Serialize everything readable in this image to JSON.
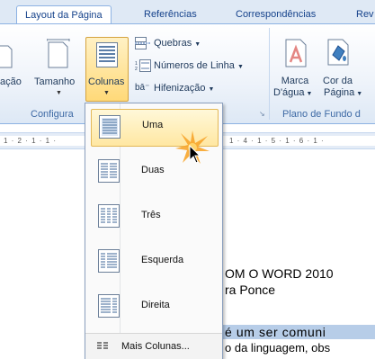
{
  "tabs": [
    {
      "label": "Layout da Página",
      "active": true
    },
    {
      "label": "Referências"
    },
    {
      "label": "Correspondências"
    },
    {
      "label": "Rev"
    }
  ],
  "ribbon": {
    "page_setup": {
      "orientation_label_partial": "ação",
      "size_label": "Tamanho",
      "columns_label": "Colunas",
      "group_title_partial": "Configura",
      "small_buttons": {
        "breaks": "Quebras",
        "line_numbers": "Números de Linha",
        "hyphenation": "Hifenização"
      }
    },
    "page_background": {
      "watermark_line1": "Marca",
      "watermark_line2": "D'água",
      "page_color_line1": "Cor da",
      "page_color_line2": "Página",
      "group_title_partial": "Plano de Fundo d"
    }
  },
  "ruler": {
    "left_text": "1 · 2 · 1 · 1 ·",
    "right_text": "1 · 4 · 1 · 5 · 1 · 6 · 1 ·"
  },
  "document": {
    "line1": "OM O WORD 2010",
    "line2": "ra Ponce",
    "line3": "é um ser comuni",
    "line4": "o da linguagem, obs"
  },
  "columns_menu": {
    "items": [
      {
        "label": "Uma",
        "selected": true
      },
      {
        "label": "Duas"
      },
      {
        "label": "Três"
      },
      {
        "label": "Esquerda"
      },
      {
        "label": "Direita"
      }
    ],
    "more_columns": "Mais Colunas..."
  },
  "colors": {
    "accent": "#15428b",
    "ribbon_border": "#8db2e3",
    "selection": "#ffe7a2",
    "highlight": "#b7cde8"
  }
}
